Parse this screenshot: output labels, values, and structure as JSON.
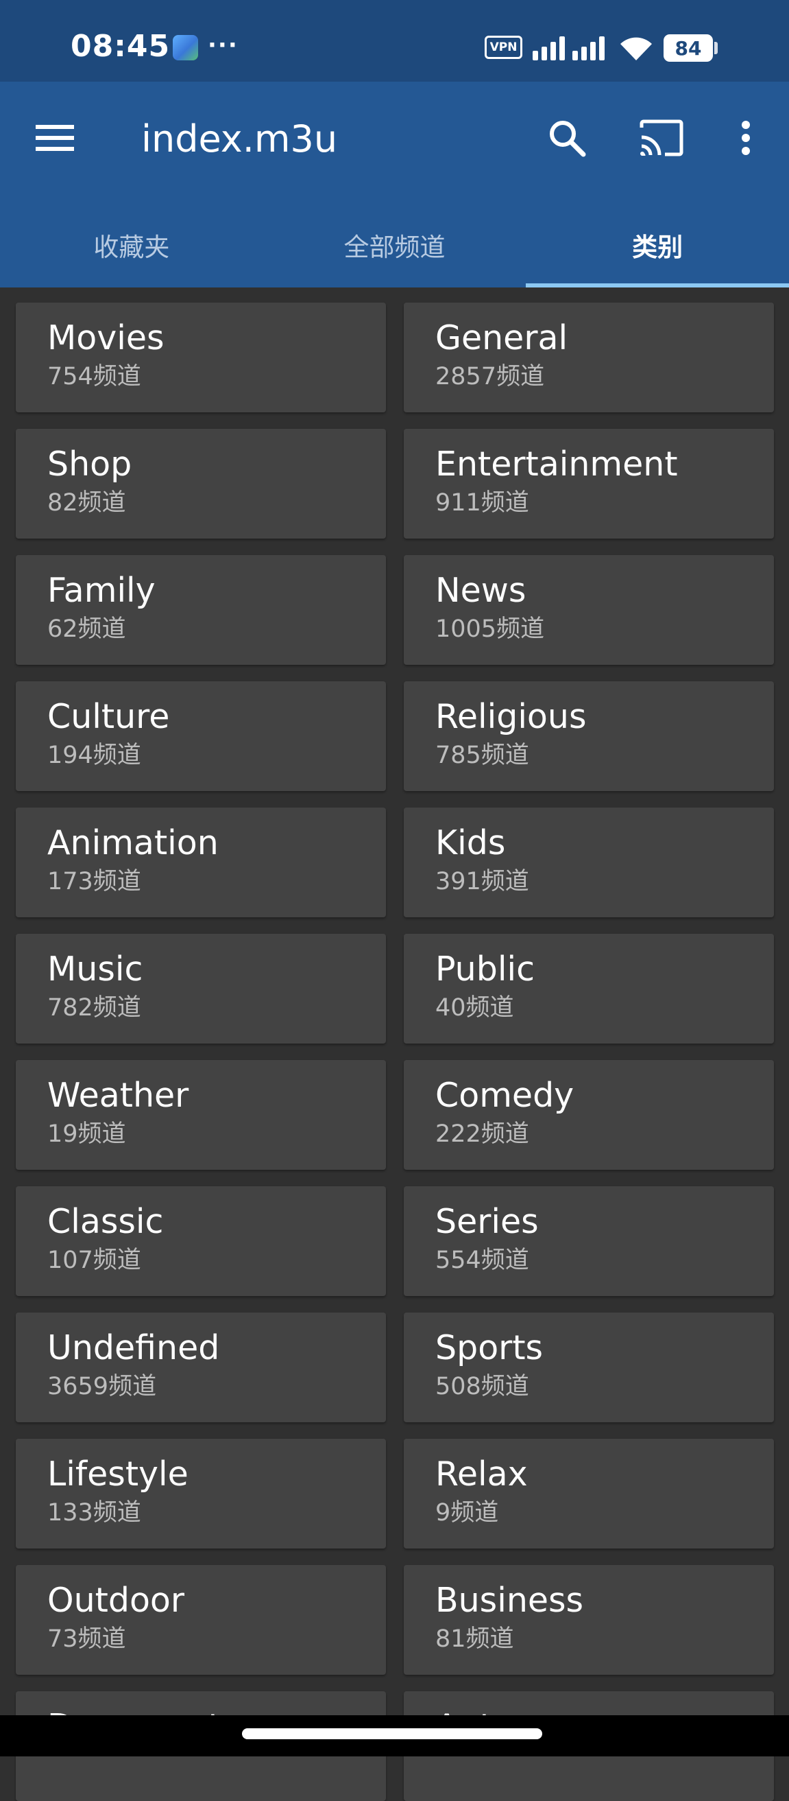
{
  "status_bar": {
    "time": "08:45",
    "more": "···",
    "vpn": "VPN",
    "battery": "84"
  },
  "app_bar": {
    "title": "index.m3u",
    "background": "#245894",
    "icons": [
      "menu-icon",
      "search-icon",
      "cast-icon",
      "more-vert-icon"
    ]
  },
  "tabs": [
    {
      "label": "收藏夹",
      "active": false
    },
    {
      "label": "全部频道",
      "active": false
    },
    {
      "label": "类别",
      "active": true
    }
  ],
  "categories": [
    {
      "name": "Movies",
      "count": "754频道"
    },
    {
      "name": "General",
      "count": "2857频道"
    },
    {
      "name": "Shop",
      "count": "82频道"
    },
    {
      "name": "Entertainment",
      "count": "911频道"
    },
    {
      "name": "Family",
      "count": "62频道"
    },
    {
      "name": "News",
      "count": "1005频道"
    },
    {
      "name": "Culture",
      "count": "194频道"
    },
    {
      "name": "Religious",
      "count": "785频道"
    },
    {
      "name": "Animation",
      "count": "173频道"
    },
    {
      "name": "Kids",
      "count": "391频道"
    },
    {
      "name": "Music",
      "count": "782频道"
    },
    {
      "name": "Public",
      "count": "40频道"
    },
    {
      "name": "Weather",
      "count": "19频道"
    },
    {
      "name": "Comedy",
      "count": "222频道"
    },
    {
      "name": "Classic",
      "count": "107频道"
    },
    {
      "name": "Series",
      "count": "554频道"
    },
    {
      "name": "Undefined",
      "count": "3659频道"
    },
    {
      "name": "Sports",
      "count": "508频道"
    },
    {
      "name": "Lifestyle",
      "count": "133频道"
    },
    {
      "name": "Relax",
      "count": "9频道"
    },
    {
      "name": "Outdoor",
      "count": "73频道"
    },
    {
      "name": "Business",
      "count": "81频道"
    },
    {
      "name": "Documentary",
      "count": ""
    },
    {
      "name": "Auto",
      "count": ""
    }
  ]
}
